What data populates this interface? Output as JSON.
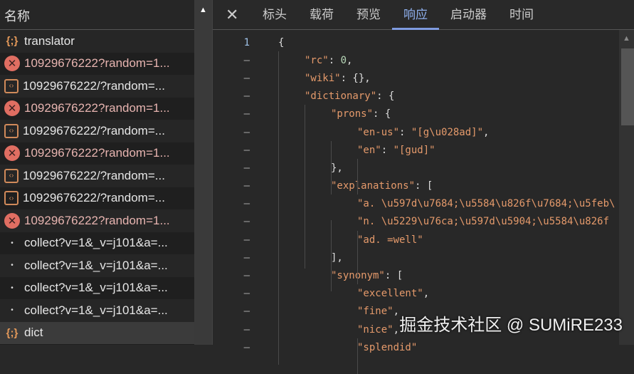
{
  "sidebar": {
    "header": "名称",
    "items": [
      {
        "type": "js",
        "label": "translator"
      },
      {
        "type": "err",
        "label": "10929676222?random=1..."
      },
      {
        "type": "doc",
        "label": "10929676222/?random=..."
      },
      {
        "type": "err",
        "label": "10929676222?random=1..."
      },
      {
        "type": "doc",
        "label": "10929676222/?random=..."
      },
      {
        "type": "err",
        "label": "10929676222?random=1..."
      },
      {
        "type": "doc",
        "label": "10929676222/?random=..."
      },
      {
        "type": "doc",
        "label": "10929676222/?random=..."
      },
      {
        "type": "err",
        "label": "10929676222?random=1..."
      },
      {
        "type": "dot",
        "label": "collect?v=1&_v=j101&a=..."
      },
      {
        "type": "dot",
        "label": "collect?v=1&_v=j101&a=..."
      },
      {
        "type": "dot",
        "label": "collect?v=1&_v=j101&a=..."
      },
      {
        "type": "dot",
        "label": "collect?v=1&_v=j101&a=..."
      },
      {
        "type": "js",
        "label": "dict",
        "selected": true
      }
    ]
  },
  "tabs": {
    "close": "✕",
    "items": [
      "标头",
      "载荷",
      "预览",
      "响应",
      "启动器",
      "时间"
    ],
    "active": 3
  },
  "code": [
    {
      "n": "1",
      "indent": 0,
      "parts": [
        [
          "p",
          "{"
        ]
      ]
    },
    {
      "n": "–",
      "indent": 1,
      "parts": [
        [
          "k",
          "\"rc\""
        ],
        [
          "p",
          ": "
        ],
        [
          "num",
          "0"
        ],
        [
          "p",
          ","
        ]
      ]
    },
    {
      "n": "–",
      "indent": 1,
      "parts": [
        [
          "k",
          "\"wiki\""
        ],
        [
          "p",
          ": {},"
        ]
      ]
    },
    {
      "n": "–",
      "indent": 1,
      "parts": [
        [
          "k",
          "\"dictionary\""
        ],
        [
          "p",
          ": {"
        ]
      ]
    },
    {
      "n": "–",
      "indent": 2,
      "parts": [
        [
          "k",
          "\"prons\""
        ],
        [
          "p",
          ": {"
        ]
      ]
    },
    {
      "n": "–",
      "indent": 3,
      "parts": [
        [
          "k",
          "\"en-us\""
        ],
        [
          "p",
          ": "
        ],
        [
          "s",
          "\"[g\\u028ad]\""
        ],
        [
          "p",
          ","
        ]
      ]
    },
    {
      "n": "–",
      "indent": 3,
      "parts": [
        [
          "k",
          "\"en\""
        ],
        [
          "p",
          ": "
        ],
        [
          "s",
          "\"[gud]\""
        ]
      ]
    },
    {
      "n": "–",
      "indent": 2,
      "parts": [
        [
          "p",
          "},"
        ]
      ]
    },
    {
      "n": "–",
      "indent": 2,
      "parts": [
        [
          "k",
          "\"explanations\""
        ],
        [
          "p",
          ": ["
        ]
      ]
    },
    {
      "n": "–",
      "indent": 3,
      "parts": [
        [
          "s",
          "\"a. \\u597d\\u7684;\\u5584\\u826f\\u7684;\\u5feb\\"
        ]
      ]
    },
    {
      "n": "–",
      "indent": 3,
      "parts": [
        [
          "s",
          "\"n. \\u5229\\u76ca;\\u597d\\u5904;\\u5584\\u826f"
        ]
      ]
    },
    {
      "n": "–",
      "indent": 3,
      "parts": [
        [
          "s",
          "\"ad. =well\""
        ]
      ]
    },
    {
      "n": "–",
      "indent": 2,
      "parts": [
        [
          "p",
          "],"
        ]
      ]
    },
    {
      "n": "–",
      "indent": 2,
      "parts": [
        [
          "k",
          "\"synonym\""
        ],
        [
          "p",
          ": ["
        ]
      ]
    },
    {
      "n": "–",
      "indent": 3,
      "parts": [
        [
          "s",
          "\"excellent\""
        ],
        [
          "p",
          ","
        ]
      ]
    },
    {
      "n": "–",
      "indent": 3,
      "parts": [
        [
          "s",
          "\"fine\""
        ],
        [
          "p",
          ","
        ]
      ]
    },
    {
      "n": "–",
      "indent": 3,
      "parts": [
        [
          "s",
          "\"nice\""
        ],
        [
          "p",
          ","
        ]
      ]
    },
    {
      "n": "–",
      "indent": 3,
      "parts": [
        [
          "s",
          "\"splendid\""
        ]
      ]
    }
  ],
  "watermark": "掘金技术社区 @ SUMiRE233"
}
